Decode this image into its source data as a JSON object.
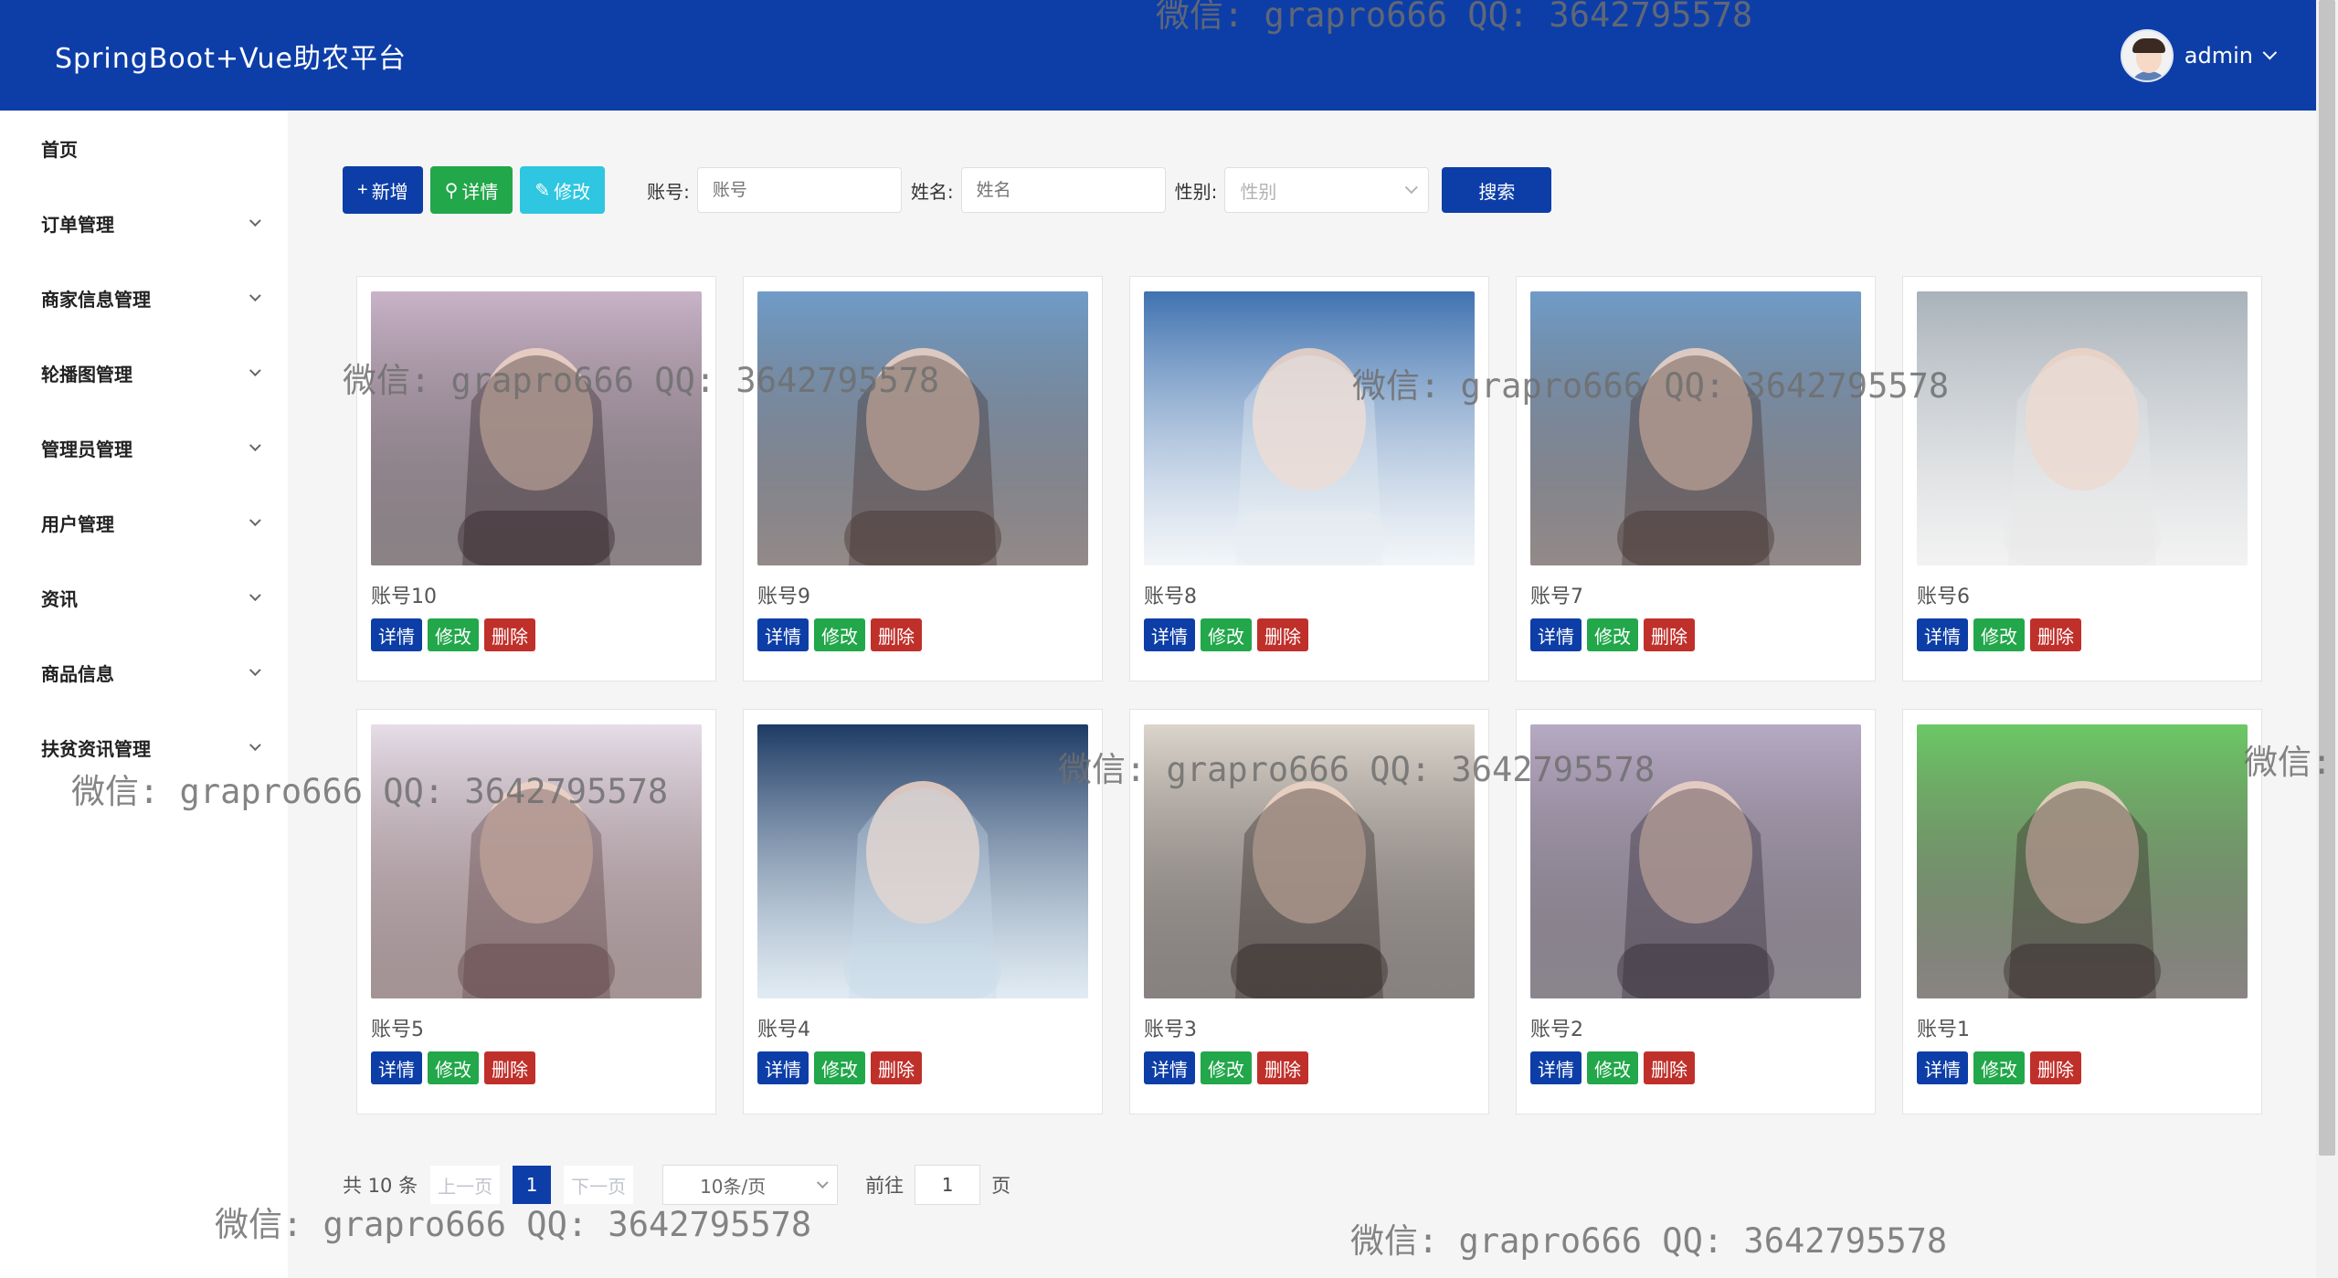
{
  "header": {
    "title": "SpringBoot+Vue助农平台",
    "username": "admin"
  },
  "sidebar": {
    "items": [
      {
        "label": "首页",
        "expandable": false
      },
      {
        "label": "订单管理",
        "expandable": true
      },
      {
        "label": "商家信息管理",
        "expandable": true
      },
      {
        "label": "轮播图管理",
        "expandable": true
      },
      {
        "label": "管理员管理",
        "expandable": true
      },
      {
        "label": "用户管理",
        "expandable": true
      },
      {
        "label": "资讯",
        "expandable": true
      },
      {
        "label": "商品信息",
        "expandable": true
      },
      {
        "label": "扶贫资讯管理",
        "expandable": true
      }
    ]
  },
  "toolbar": {
    "add_label": "新增",
    "detail_label": "详情",
    "edit_label": "修改",
    "account_label": "账号:",
    "account_placeholder": "账号",
    "name_label": "姓名:",
    "name_placeholder": "姓名",
    "gender_label": "性别:",
    "gender_placeholder": "性别",
    "search_label": "搜索"
  },
  "cards": [
    {
      "title": "账号10",
      "colors": [
        "#c9b3c8",
        "#2a1c22"
      ]
    },
    {
      "title": "账号9",
      "colors": [
        "#6f9cc8",
        "#3b2b29"
      ]
    },
    {
      "title": "账号8",
      "colors": [
        "#3f72b0",
        "#e9eef3"
      ]
    },
    {
      "title": "账号7",
      "colors": [
        "#6f9cc8",
        "#3b2b29"
      ]
    },
    {
      "title": "账号6",
      "colors": [
        "#a9b2ba",
        "#e8e8e8"
      ]
    },
    {
      "title": "账号5",
      "colors": [
        "#e6dde8",
        "#5a3b3e"
      ]
    },
    {
      "title": "账号4",
      "colors": [
        "#1d3a63",
        "#c9dbe9"
      ]
    },
    {
      "title": "账号3",
      "colors": [
        "#dcd5cc",
        "#251c1a"
      ]
    },
    {
      "title": "账号2",
      "colors": [
        "#b7aac4",
        "#2b2230"
      ]
    },
    {
      "title": "账号1",
      "colors": [
        "#6cc865",
        "#2a1f1d"
      ]
    }
  ],
  "card_actions": {
    "detail": "详情",
    "edit": "修改",
    "delete": "删除"
  },
  "pagination": {
    "total_text": "共 10 条",
    "prev": "上一页",
    "current_page": "1",
    "next": "下一页",
    "page_size": "10条/页",
    "goto_label": "前往",
    "goto_value": "1",
    "page_suffix": "页"
  },
  "watermark": {
    "text": "微信: grapro666 QQ: 3642795578",
    "partial": "微信:"
  },
  "colors": {
    "primary": "#0d3ea8",
    "success": "#22a74a",
    "info": "#2ec6e0",
    "danger": "#c0302b"
  }
}
